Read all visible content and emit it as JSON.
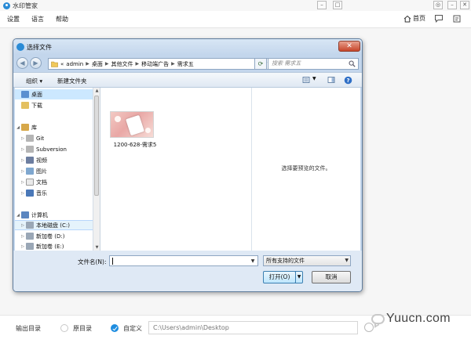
{
  "app": {
    "title": "水印管家",
    "menu": [
      "设置",
      "语言",
      "帮助"
    ],
    "home_label": "首页",
    "footer": {
      "output_label": "输出目录",
      "option_original": "原目录",
      "option_custom": "自定义",
      "selected_option": "自定义",
      "output_path": "C:\\Users\\admin\\Desktop"
    }
  },
  "dialog": {
    "title": "选择文件",
    "close_label": "✕",
    "breadcrumb": [
      "admin",
      "桌面",
      "其他文件",
      "移动端广告",
      "需求五"
    ],
    "breadcrumb_prefix": "«",
    "search_placeholder": "搜索 需求五",
    "toolbar": {
      "organize_label": "组织 ▾",
      "new_folder_label": "新建文件夹"
    },
    "nav_tree": [
      {
        "label": "桌面",
        "icon": "desktop-folder-icon",
        "state": "selected"
      },
      {
        "label": "下载",
        "icon": "downloads-folder-icon",
        "state": ""
      },
      {
        "label": "库",
        "icon": "library-icon",
        "state": ""
      },
      {
        "label": "Git",
        "icon": "folder-icon",
        "state": ""
      },
      {
        "label": "Subversion",
        "icon": "folder-icon",
        "state": ""
      },
      {
        "label": "视频",
        "icon": "video-library-icon",
        "state": ""
      },
      {
        "label": "图片",
        "icon": "pictures-library-icon",
        "state": ""
      },
      {
        "label": "文档",
        "icon": "documents-library-icon",
        "state": ""
      },
      {
        "label": "音乐",
        "icon": "music-library-icon",
        "state": ""
      },
      {
        "label": "计算机",
        "icon": "computer-icon",
        "state": ""
      },
      {
        "label": "本地磁盘 (C:)",
        "icon": "drive-icon",
        "state": "highlighted"
      },
      {
        "label": "新加卷 (D:)",
        "icon": "drive-icon",
        "state": ""
      },
      {
        "label": "新加卷 (E:)",
        "icon": "drive-icon",
        "state": ""
      }
    ],
    "files": [
      {
        "name": "1200-628-需求5",
        "icon": "image-thumbnail-icon"
      }
    ],
    "preview_text": "选择要预览的文件。",
    "filename_label": "文件名(N):",
    "filename_value": "",
    "filter_label": "所有支持的文件",
    "open_label": "打开(O)",
    "cancel_label": "取消"
  },
  "watermark": {
    "text": "Yuucn.com"
  },
  "colors": {
    "accent": "#1e8de0",
    "dialog_frame": "#c3d6ec",
    "selection": "#cce8ff"
  }
}
